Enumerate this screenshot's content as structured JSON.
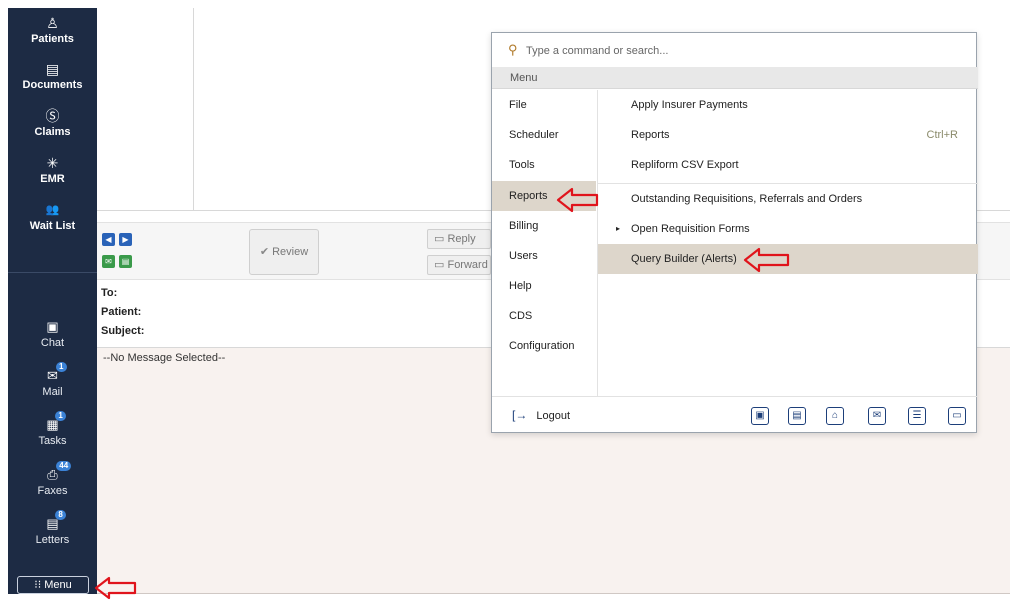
{
  "sidebar": {
    "top_items": [
      {
        "label": "Patients",
        "icon": "person-icon"
      },
      {
        "label": "Documents",
        "icon": "document-icon"
      },
      {
        "label": "Claims",
        "icon": "dollar-icon"
      },
      {
        "label": "EMR",
        "icon": "emr-icon"
      },
      {
        "label": "Wait List",
        "icon": "group-icon"
      }
    ],
    "bottom_items": [
      {
        "label": "Chat",
        "icon": "chat-icon",
        "badge": ""
      },
      {
        "label": "Mail",
        "icon": "mail-icon",
        "badge": "1"
      },
      {
        "label": "Tasks",
        "icon": "tasks-icon",
        "badge": "1"
      },
      {
        "label": "Faxes",
        "icon": "fax-icon",
        "badge": "44"
      },
      {
        "label": "Letters",
        "icon": "letters-icon",
        "badge": "8"
      }
    ],
    "menu_label": "⁝⁝ Menu"
  },
  "toolbar": {
    "review_label": "Review",
    "reply_label": "Reply",
    "forward_label": "Forward"
  },
  "message": {
    "to_label": "To:",
    "patient_label": "Patient:",
    "subject_label": "Subject:",
    "empty_text": "--No Message Selected--"
  },
  "command_menu": {
    "search_placeholder": "Type a command or search...",
    "menu_header": "Menu",
    "categories": [
      "File",
      "Scheduler",
      "Tools",
      "Reports",
      "Billing",
      "Users",
      "Help",
      "CDS",
      "Configuration"
    ],
    "active_category": "Reports",
    "items": [
      {
        "label": "Apply Insurer Payments",
        "shortcut": ""
      },
      {
        "label": "Reports",
        "shortcut": "Ctrl+R"
      },
      {
        "label": "Repliform CSV Export",
        "shortcut": ""
      },
      {
        "label": "Outstanding Requisitions, Referrals and Orders",
        "shortcut": ""
      },
      {
        "label": "Open Requisition Forms",
        "shortcut": ""
      },
      {
        "label": "Query Builder (Alerts)",
        "shortcut": ""
      }
    ],
    "active_item": "Query Builder (Alerts)",
    "logout_label": "Logout"
  },
  "colors": {
    "sidebar_bg": "#1d2b44",
    "highlight": "#ddd6cb",
    "annotation_arrow": "#e0141c",
    "icon_blue": "#1d3f7a"
  }
}
